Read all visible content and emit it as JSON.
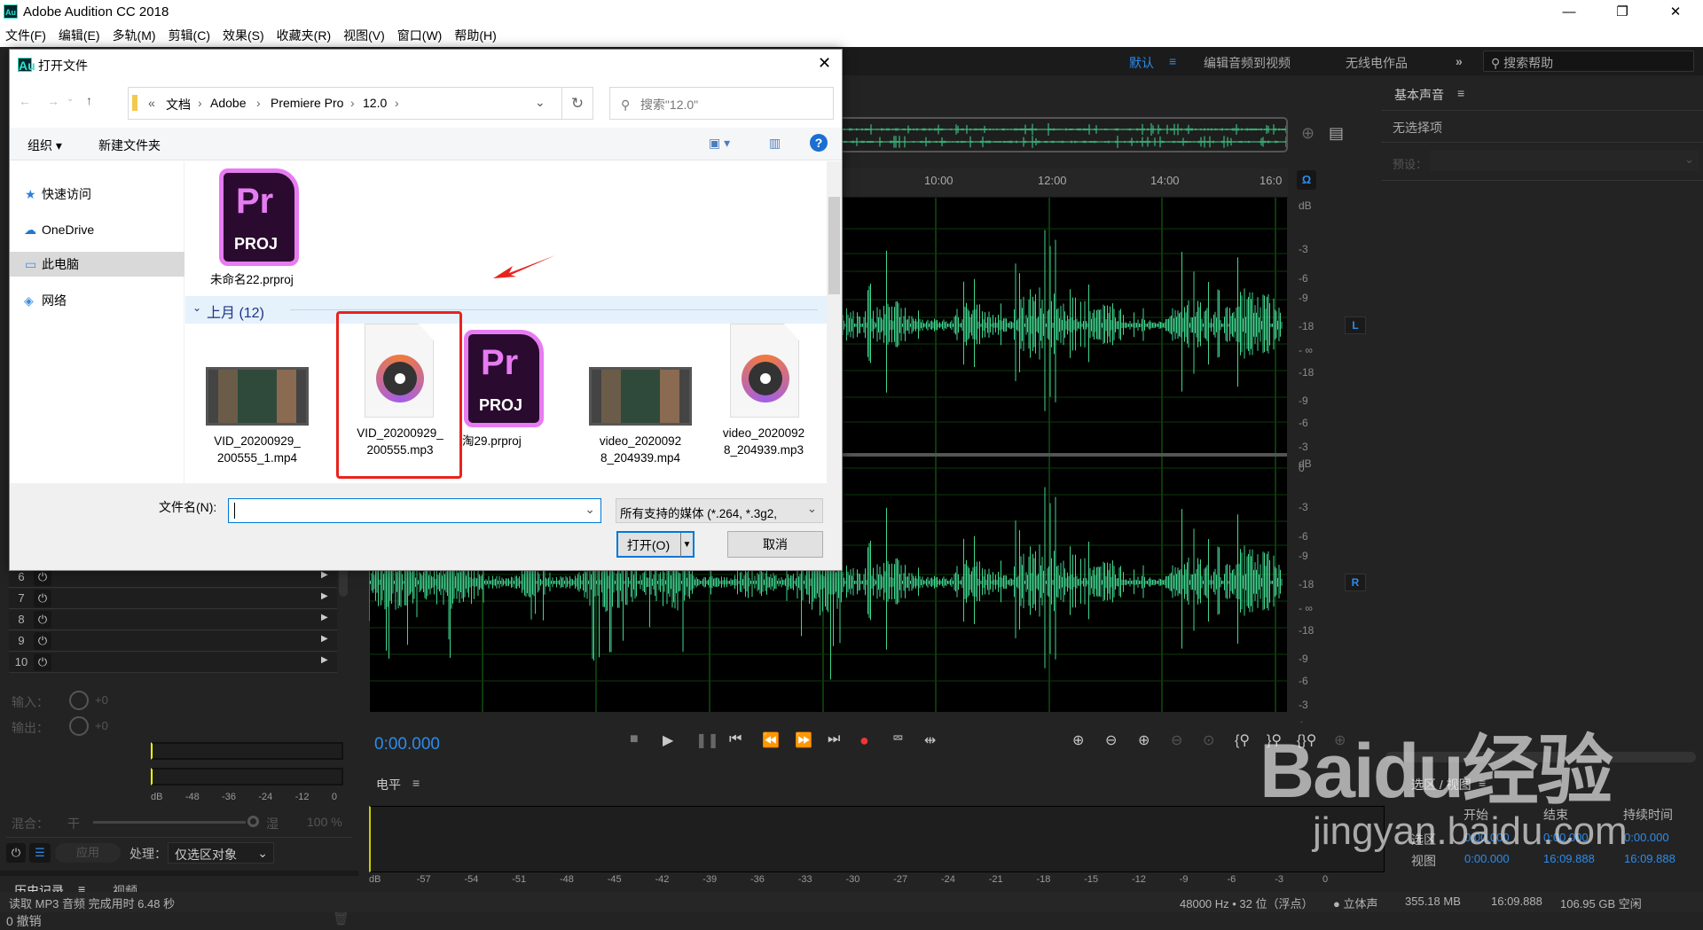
{
  "app": {
    "title": "Adobe Audition CC 2018",
    "logo": "Au",
    "window_controls": [
      "minimize",
      "restore",
      "close"
    ]
  },
  "menu": [
    "文件(F)",
    "编辑(E)",
    "多轨(M)",
    "剪辑(C)",
    "效果(S)",
    "收藏夹(R)",
    "视图(V)",
    "窗口(W)",
    "帮助(H)"
  ],
  "workspace": {
    "items": [
      "默认",
      "编辑音频到视频",
      "无线电作品"
    ],
    "active": "默认",
    "menu_icon": "≡",
    "more_icon": "»",
    "search_placeholder": "搜索帮助"
  },
  "right_panel": {
    "title": "基本声音",
    "menu_icon": "≡",
    "no_selection": "无选择项",
    "preset_label": "预设："
  },
  "editor": {
    "timeline_labels": [
      "10:00",
      "12:00",
      "14:00",
      "16:0"
    ],
    "db_scale": [
      "dB",
      "-3",
      "-6",
      "-9",
      "-18",
      "- ∞",
      "-18",
      "-9",
      "-6",
      "-3",
      "0"
    ],
    "channels": [
      "L",
      "R"
    ],
    "waveform_color": "#41d68f",
    "current_time": "0:00.000",
    "time_color": "#2d8ceb"
  },
  "transport": [
    "stop",
    "play",
    "pause",
    "go-to-start",
    "rewind",
    "fast-forward",
    "go-to-end",
    "record",
    "loop",
    "skip-selection"
  ],
  "zoom_tools": [
    "zoom-in-amplitude",
    "zoom-out-amplitude",
    "zoom-in-time",
    "zoom-out-time",
    "zoom-reset",
    "zoom-in-point",
    "zoom-out-point",
    "zoom-selection",
    "zoom-full"
  ],
  "level": {
    "title": "电平",
    "menu_icon": "≡",
    "scale": [
      "dB",
      "-57",
      "-54",
      "-51",
      "-48",
      "-45",
      "-42",
      "-39",
      "-36",
      "-33",
      "-30",
      "-27",
      "-24",
      "-21",
      "-18",
      "-15",
      "-12",
      "-9",
      "-6",
      "-3",
      "0"
    ]
  },
  "selection_view": {
    "title": "选区 / 视图",
    "menu_icon": "≡",
    "columns": [
      "开始",
      "结束",
      "持续时间"
    ],
    "rows": [
      {
        "label": "选区",
        "start": "0:00.000",
        "end": "0:00.000",
        "duration": "0:00.000"
      },
      {
        "label": "视图",
        "start": "0:00.000",
        "end": "16:09.888",
        "duration": "16:09.888"
      }
    ]
  },
  "effects_rack": {
    "rows": [
      "6",
      "7",
      "8",
      "9",
      "10"
    ],
    "input_label": "输入：",
    "output_label": "输出：",
    "input_gain": "+0",
    "output_gain": "+0",
    "meter_scale": [
      "dB",
      "-48",
      "-36",
      "-24",
      "-12",
      "0"
    ],
    "mix_label": "混合：",
    "dry": "干",
    "wet": "湿",
    "mix_percent": "100 %",
    "mix_value": 100,
    "apply": "应用",
    "process_label": "处理：",
    "process_value": "仅选区对象"
  },
  "history": {
    "tabs": [
      "历史记录",
      "视频"
    ],
    "active": "历史记录",
    "undo_count": "0 撤销"
  },
  "status": {
    "message": "读取 MP3 音频 完成用时 6.48 秒",
    "sample": "48000 Hz • 32 位（浮点）",
    "channels": "● 立体声",
    "size": "355.18 MB",
    "duration": "16:09.888",
    "free": "106.95 GB 空闲"
  },
  "dialog": {
    "title": "打开文件",
    "breadcrumb": [
      "«",
      "文档",
      "Adobe",
      "Premiere Pro",
      "12.0"
    ],
    "search_placeholder": "搜索\"12.0\"",
    "organize": "组织 ▾",
    "new_folder": "新建文件夹",
    "nav": [
      "快速访问",
      "OneDrive",
      "此电脑",
      "网络"
    ],
    "nav_selected": "此电脑",
    "top_file": {
      "name": "未命名22.prproj",
      "type": "prproj"
    },
    "group": "上月 (12)",
    "files": [
      {
        "line1": "VID_20200929_",
        "line2": "200555_1.mp4",
        "type": "video"
      },
      {
        "line1": "VID_20200929_",
        "line2": "200555.mp3",
        "type": "audio",
        "highlighted": true
      },
      {
        "line1": "淘29.prproj",
        "line2": "",
        "type": "prproj"
      },
      {
        "line1": "video_2020092",
        "line2": "8_204939.mp4",
        "type": "video"
      },
      {
        "line1": "video_2020092",
        "line2": "8_204939.mp3",
        "type": "audio"
      }
    ],
    "filename_label": "文件名(N):",
    "filename_value": "",
    "filter": "所有支持的媒体 (*.264, *.3g2,",
    "open": "打开(O)",
    "cancel": "取消"
  },
  "watermark": {
    "brand": "Baidu经验",
    "url": "jingyan.baidu.com"
  }
}
